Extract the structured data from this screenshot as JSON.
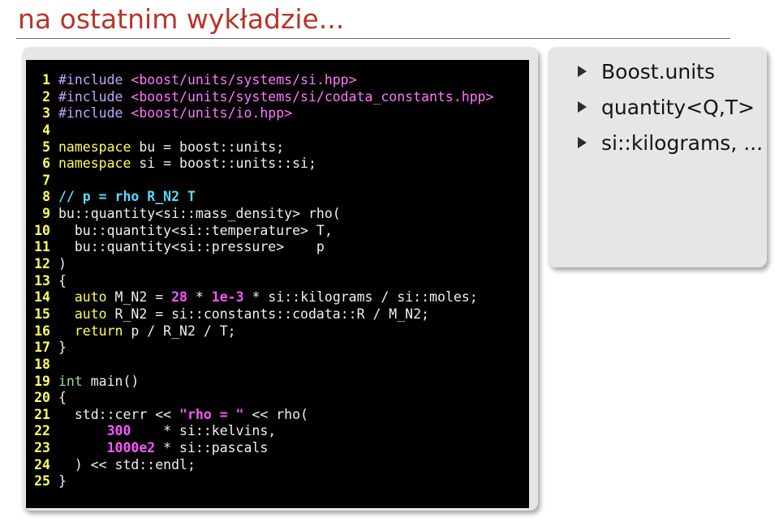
{
  "slide": {
    "title": "na ostatnim wykładzie..."
  },
  "code": {
    "lines": [
      [
        {
          "t": "#include ",
          "c": "tok-pre"
        },
        {
          "t": "<boost/units/systems/si.hpp>",
          "c": "tok-inc"
        }
      ],
      [
        {
          "t": "#include ",
          "c": "tok-pre"
        },
        {
          "t": "<boost/units/systems/si/codata_constants.hpp>",
          "c": "tok-inc"
        }
      ],
      [
        {
          "t": "#include ",
          "c": "tok-pre"
        },
        {
          "t": "<boost/units/io.hpp>",
          "c": "tok-inc"
        }
      ],
      [],
      [
        {
          "t": "namespace",
          "c": "tok-kw"
        },
        {
          "t": " bu = boost::units;",
          "c": "tok-plain"
        }
      ],
      [
        {
          "t": "namespace",
          "c": "tok-kw"
        },
        {
          "t": " si = boost::units::si;",
          "c": "tok-plain"
        }
      ],
      [],
      [
        {
          "t": "// p = rho R_N2 T",
          "c": "tok-cm"
        }
      ],
      [
        {
          "t": "bu::quantity<si::mass_density> rho(",
          "c": "tok-plain"
        }
      ],
      [
        {
          "t": "  bu::quantity<si::temperature> T,",
          "c": "tok-plain"
        }
      ],
      [
        {
          "t": "  bu::quantity<si::pressure>    p",
          "c": "tok-plain"
        }
      ],
      [
        {
          "t": ")",
          "c": "tok-plain"
        }
      ],
      [
        {
          "t": "{",
          "c": "tok-plain"
        }
      ],
      [
        {
          "t": "  ",
          "c": "tok-plain"
        },
        {
          "t": "auto",
          "c": "tok-kw"
        },
        {
          "t": " M_N2 = ",
          "c": "tok-plain"
        },
        {
          "t": "28",
          "c": "tok-num"
        },
        {
          "t": " * ",
          "c": "tok-plain"
        },
        {
          "t": "1e-3",
          "c": "tok-num"
        },
        {
          "t": " * si::kilograms / si::moles;",
          "c": "tok-plain"
        }
      ],
      [
        {
          "t": "  ",
          "c": "tok-plain"
        },
        {
          "t": "auto",
          "c": "tok-kw"
        },
        {
          "t": " R_N2 = si::constants::codata::R / M_N2;",
          "c": "tok-plain"
        }
      ],
      [
        {
          "t": "  ",
          "c": "tok-plain"
        },
        {
          "t": "return",
          "c": "tok-kw"
        },
        {
          "t": " p / R_N2 / T;",
          "c": "tok-plain"
        }
      ],
      [
        {
          "t": "}",
          "c": "tok-plain"
        }
      ],
      [],
      [
        {
          "t": "int",
          "c": "tok-ty"
        },
        {
          "t": " main()",
          "c": "tok-plain"
        }
      ],
      [
        {
          "t": "{",
          "c": "tok-plain"
        }
      ],
      [
        {
          "t": "  std::cerr << ",
          "c": "tok-plain"
        },
        {
          "t": "\"rho = \"",
          "c": "tok-str"
        },
        {
          "t": " << rho(",
          "c": "tok-plain"
        }
      ],
      [
        {
          "t": "      ",
          "c": "tok-plain"
        },
        {
          "t": "300",
          "c": "tok-num"
        },
        {
          "t": "    * si::kelvins,",
          "c": "tok-plain"
        }
      ],
      [
        {
          "t": "      ",
          "c": "tok-plain"
        },
        {
          "t": "1000e2",
          "c": "tok-num"
        },
        {
          "t": " * si::pascals",
          "c": "tok-plain"
        }
      ],
      [
        {
          "t": "  ) << std::endl;",
          "c": "tok-plain"
        }
      ],
      [
        {
          "t": "}",
          "c": "tok-plain"
        }
      ]
    ]
  },
  "notes": {
    "items": [
      "Boost.units",
      "quantity<Q,T>",
      "si::kilograms, ..."
    ]
  }
}
